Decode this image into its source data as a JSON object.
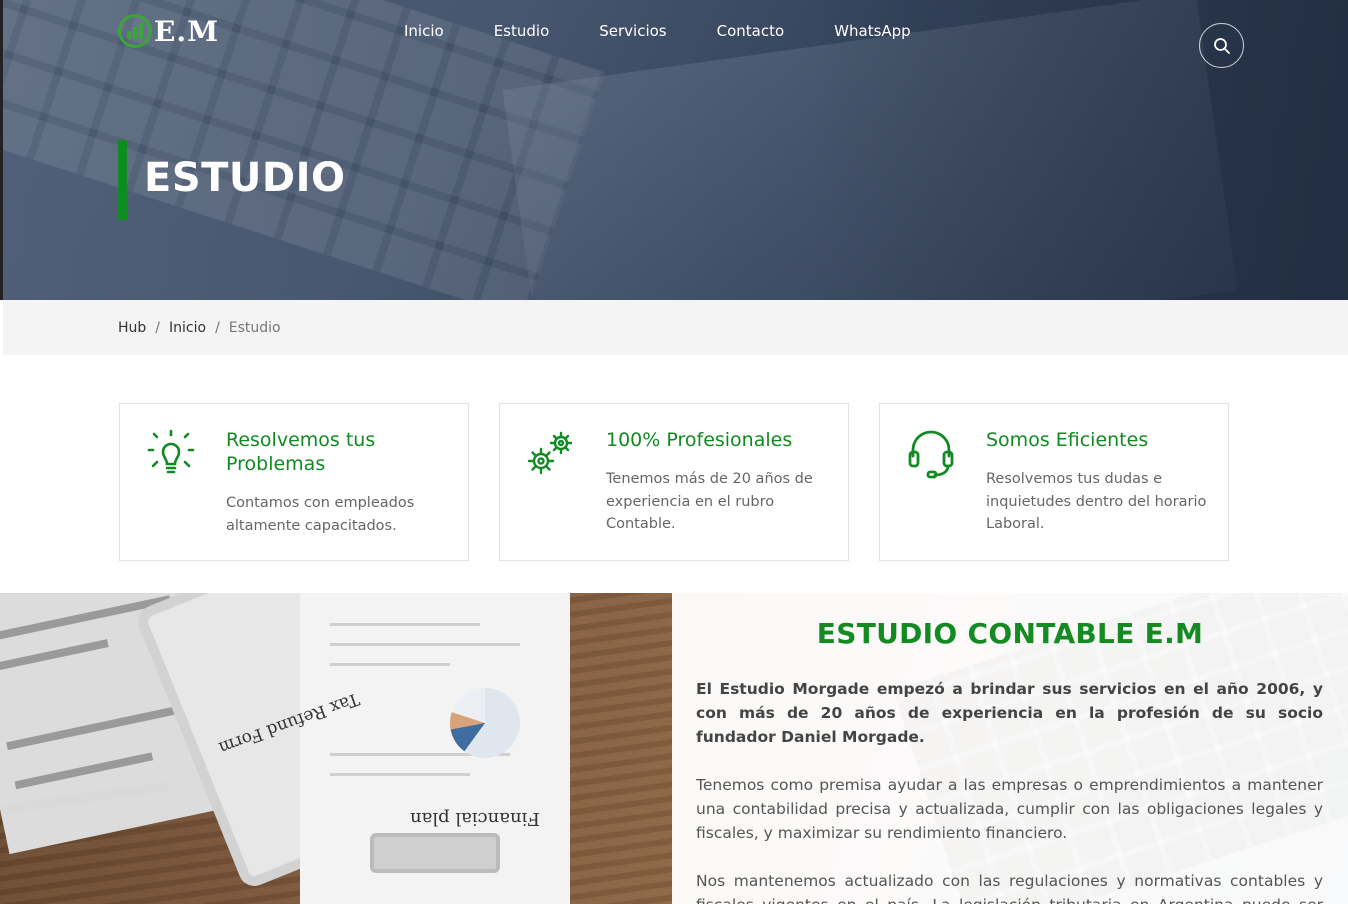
{
  "brand": {
    "logo_text": "E.M"
  },
  "nav": {
    "items": [
      {
        "label": "Inicio"
      },
      {
        "label": "Estudio"
      },
      {
        "label": "Servicios"
      },
      {
        "label": "Contacto"
      },
      {
        "label": "WhatsApp"
      }
    ],
    "search_icon": "search-icon"
  },
  "hero": {
    "title": "ESTUDIO"
  },
  "breadcrumb": {
    "items": [
      "Hub",
      "Inicio"
    ],
    "current": "Estudio",
    "separator": "/"
  },
  "features": [
    {
      "icon": "lightbulb-icon",
      "title": "Resolvemos tus Problemas",
      "text": "Contamos con empleados altamente capacitados."
    },
    {
      "icon": "gears-icon",
      "title": "100% Profesionales",
      "text": "Tenemos más de 20 años de experiencia en el rubro Contable."
    },
    {
      "icon": "headset-icon",
      "title": "Somos Eficientes",
      "text": "Resolvemos tus dudas e inquietudes dentro del horario Laboral."
    }
  ],
  "about": {
    "title": "ESTUDIO CONTABLE E.M",
    "paragraphs": [
      "El Estudio Morgade empezó a brindar sus servicios en el año 2006, y con más de 20 años de experiencia en la profesión de su socio fundador Daniel Morgade.",
      "Tenemos como premisa ayudar a las empresas o emprendimientos a mantener una contabilidad precisa y actualizada, cumplir con las obligaciones legales y fiscales, y maximizar su rendimiento financiero.",
      "Nos mantenemos actualizado con las regulaciones y normativas contables y fiscales vigentes en el país. La legislación tributaria en Argentina puede ser compleja y está"
    ],
    "image_texts": {
      "form": "Tax Refund Form",
      "plan": "Financial plan"
    }
  },
  "colors": {
    "accent": "#0f8c1f",
    "hero_bg": "#3f4e66",
    "breadcrumb_bg": "#f4f4f4"
  }
}
